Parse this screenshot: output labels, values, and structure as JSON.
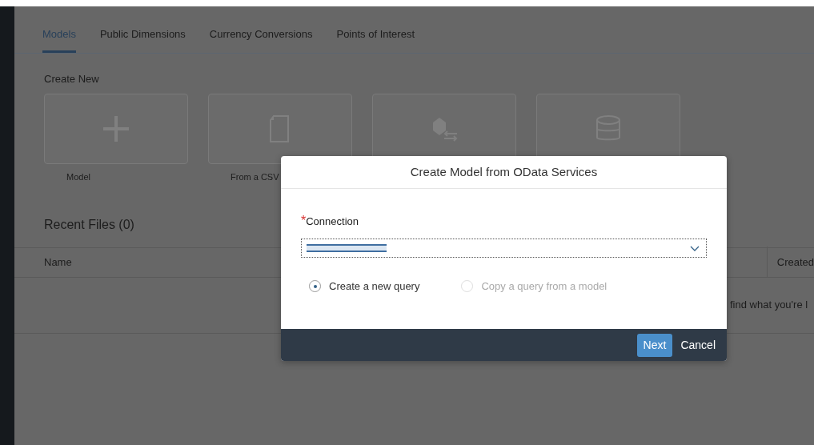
{
  "tabs": [
    {
      "label": "Models",
      "selected": true
    },
    {
      "label": "Public Dimensions",
      "selected": false
    },
    {
      "label": "Currency Conversions",
      "selected": false
    },
    {
      "label": "Points of Interest",
      "selected": false
    }
  ],
  "create_new": {
    "title": "Create New",
    "tiles": [
      {
        "kind": "plus",
        "label": "Model"
      },
      {
        "kind": "file",
        "label": "From a CSV"
      },
      {
        "kind": "cube"
      },
      {
        "kind": "database"
      }
    ]
  },
  "recent_files": {
    "title": "Recent Files (0)",
    "columns": [
      "Name",
      "Created"
    ],
    "empty_message": "find what you're l"
  },
  "dialog": {
    "title": "Create Model from OData Services",
    "field": {
      "label": "Connection",
      "required_mark": "*"
    },
    "options": [
      {
        "label": "Create a new query",
        "selected": true,
        "disabled": false
      },
      {
        "label": "Copy a query from a model",
        "selected": false,
        "disabled": true
      }
    ],
    "buttons": [
      {
        "label": "Next",
        "kind": "primary"
      },
      {
        "label": "Cancel",
        "kind": "plain"
      }
    ]
  }
}
